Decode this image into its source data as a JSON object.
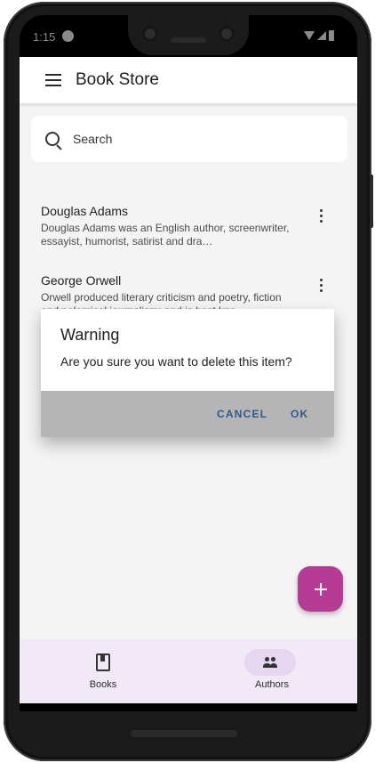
{
  "status_bar": {
    "time": "1:15"
  },
  "app_bar": {
    "title": "Book Store",
    "menu_icon": "menu-icon"
  },
  "search": {
    "placeholder": "Search",
    "icon": "search-icon"
  },
  "list": {
    "items": [
      {
        "title": "Douglas Adams",
        "description": "Douglas Adams was an English author, screenwriter, essayist, humorist, satirist and dra…"
      },
      {
        "title": "George Orwell",
        "description": "Orwell produced literary criticism and poetry, fiction and polemical journalism; and is best kno…"
      }
    ]
  },
  "dialog": {
    "title": "Warning",
    "message": "Are you sure you want to delete this item?",
    "cancel_label": "CANCEL",
    "ok_label": "OK"
  },
  "fab": {
    "icon": "plus-icon"
  },
  "bottom_nav": {
    "items": [
      {
        "label": "Books",
        "icon": "book-icon",
        "selected": false
      },
      {
        "label": "Authors",
        "icon": "people-icon",
        "selected": true
      }
    ]
  },
  "colors": {
    "accent": "#b63b96",
    "dialog_button": "#2f5a88",
    "nav_background": "#f1e9f5",
    "nav_selected_pill": "#e7d6f0"
  }
}
